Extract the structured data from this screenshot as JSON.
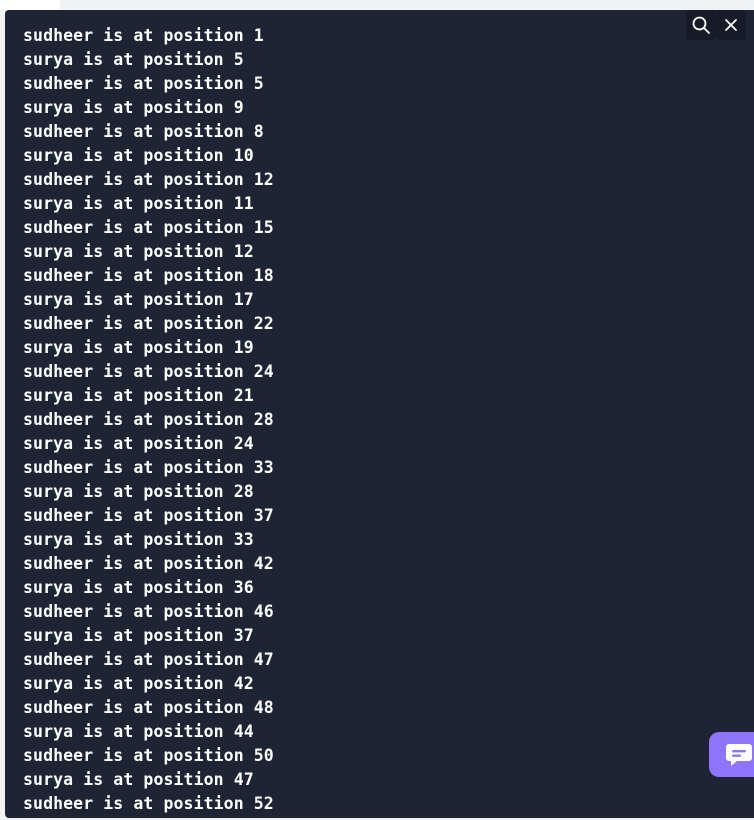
{
  "toolbar": {
    "search_icon": "search-icon",
    "close_icon": "close-icon"
  },
  "output": {
    "lines": [
      "sudheer is at position 1",
      "surya is at position 5",
      "sudheer is at position 5",
      "surya is at position 9",
      "sudheer is at position 8",
      "surya is at position 10",
      "sudheer is at position 12",
      "surya is at position 11",
      "sudheer is at position 15",
      "surya is at position 12",
      "sudheer is at position 18",
      "surya is at position 17",
      "sudheer is at position 22",
      "surya is at position 19",
      "sudheer is at position 24",
      "surya is at position 21",
      "sudheer is at position 28",
      "surya is at position 24",
      "sudheer is at position 33",
      "surya is at position 28",
      "sudheer is at position 37",
      "surya is at position 33",
      "sudheer is at position 42",
      "surya is at position 36",
      "sudheer is at position 46",
      "surya is at position 37",
      "sudheer is at position 47",
      "surya is at position 42",
      "sudheer is at position 48",
      "surya is at position 44",
      "sudheer is at position 50",
      "surya is at position 47",
      "sudheer is at position 52"
    ]
  },
  "chat": {
    "icon": "chat-icon"
  },
  "colors": {
    "terminal_bg": "#1e2433",
    "text": "#ffffff",
    "accent": "#8f74ff"
  }
}
